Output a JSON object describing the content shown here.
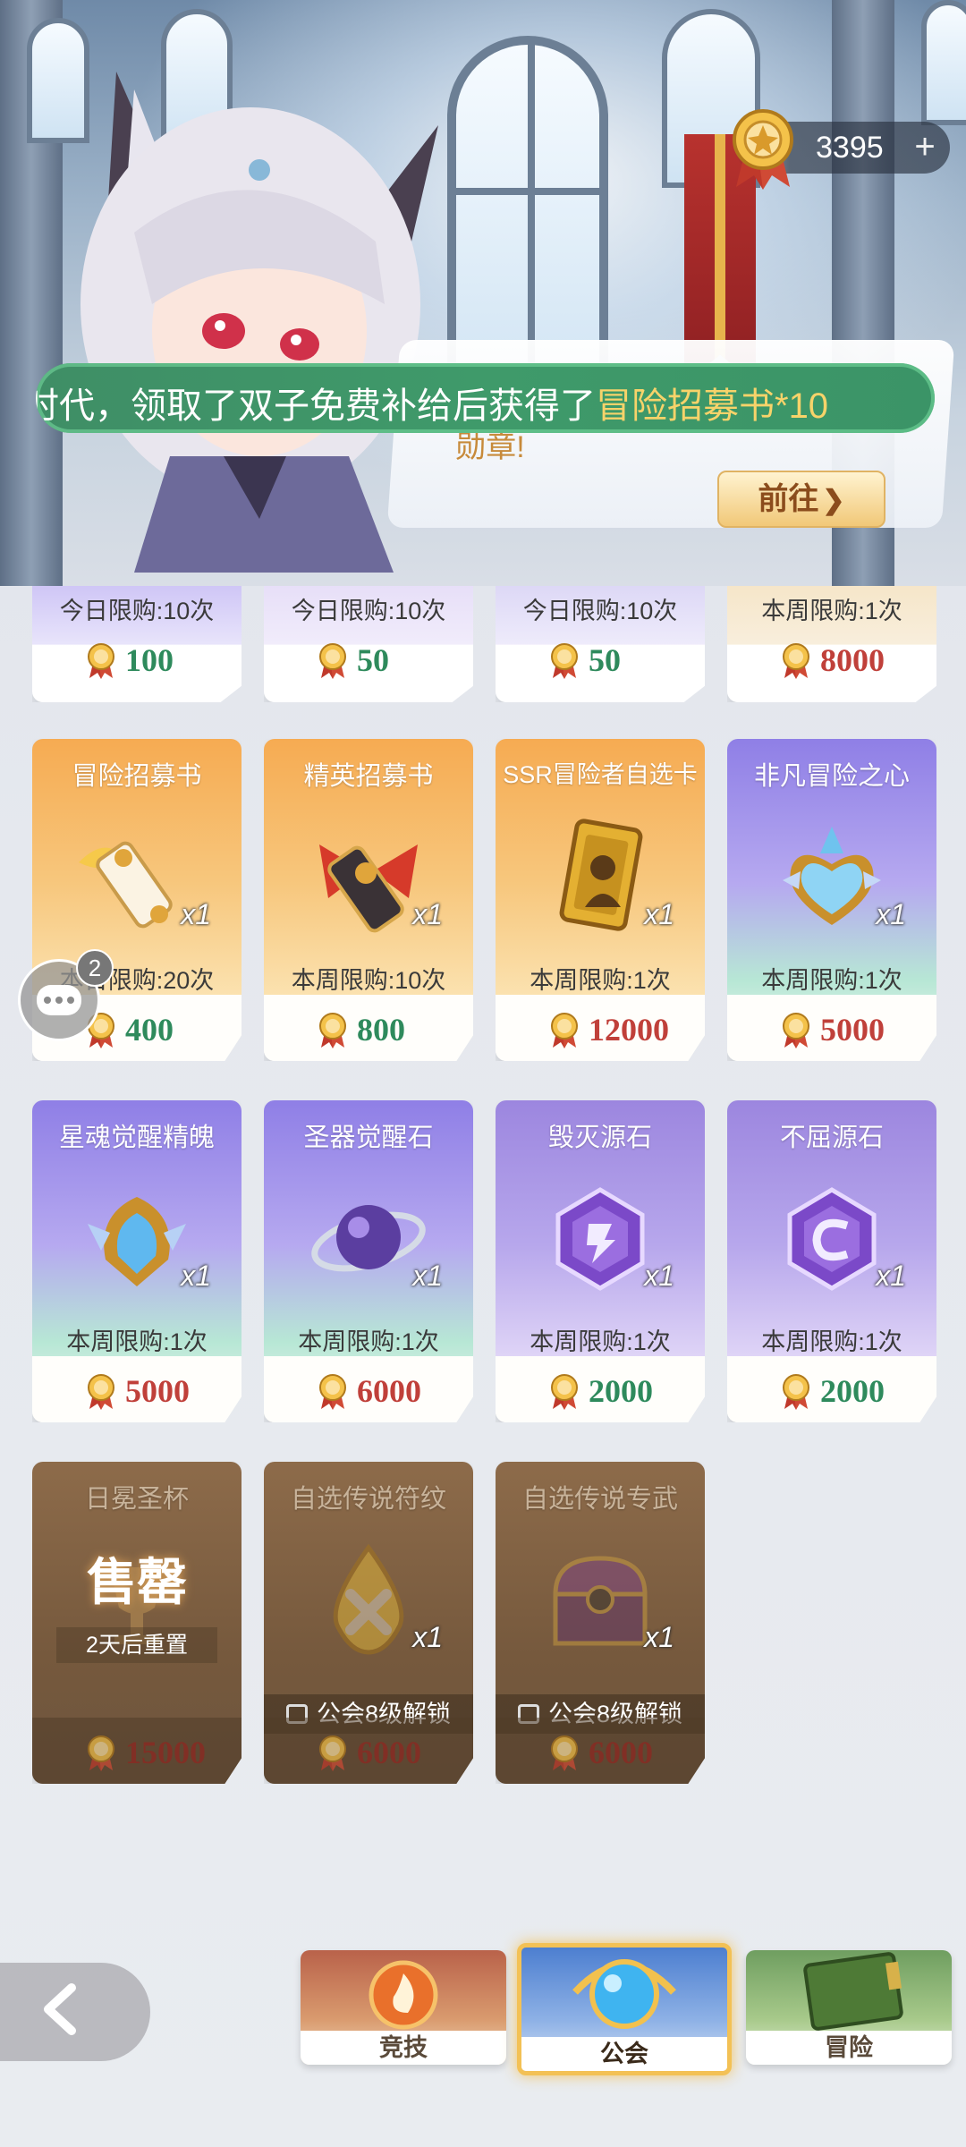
{
  "currency": {
    "amount": "3395",
    "plus_icon": "plus-icon",
    "coin_icon": "medal-coin-icon"
  },
  "hero": {
    "speech_text": "勋章!",
    "goto_label": "前往",
    "goto_icon": "chevron-right-icon"
  },
  "notice": {
    "prefix": "时代，领取了双子免费补给后获得了",
    "highlight": "冒险招募书*10"
  },
  "partial_row": [
    {
      "limit": "今日限购:10次",
      "price": "100",
      "price_color": "green"
    },
    {
      "limit": "今日限购:10次",
      "price": "50",
      "price_color": "green"
    },
    {
      "limit": "今日限购:10次",
      "price": "50",
      "price_color": "green"
    },
    {
      "limit": "本周限购:1次",
      "price": "8000",
      "price_color": "red"
    }
  ],
  "row1": [
    {
      "name": "冒险招募书",
      "icon": "scroll-icon",
      "qty": "x1",
      "limit": "本日限购:20次",
      "price": "400",
      "price_color": "green"
    },
    {
      "name": "精英招募书",
      "icon": "elite-scroll-icon",
      "qty": "x1",
      "limit": "本周限购:10次",
      "price": "800",
      "price_color": "green"
    },
    {
      "name": "SSR冒险者自选卡",
      "icon": "card-icon",
      "qty": "x1",
      "limit": "本周限购:1次",
      "price": "12000",
      "price_color": "red"
    },
    {
      "name": "非凡冒险之心",
      "icon": "heart-crystal-icon",
      "qty": "x1",
      "limit": "本周限购:1次",
      "price": "5000",
      "price_color": "red"
    }
  ],
  "row2": [
    {
      "name": "星魂觉醒精魄",
      "icon": "crystal-gem-icon",
      "qty": "x1",
      "limit": "本周限购:1次",
      "price": "5000",
      "price_color": "red"
    },
    {
      "name": "圣器觉醒石",
      "icon": "orb-icon",
      "qty": "x1",
      "limit": "本周限购:1次",
      "price": "6000",
      "price_color": "red"
    },
    {
      "name": "毁灭源石",
      "icon": "destruction-stone-icon",
      "qty": "x1",
      "limit": "本周限购:1次",
      "price": "2000",
      "price_color": "green"
    },
    {
      "name": "不屈源石",
      "icon": "unyielding-stone-icon",
      "qty": "x1",
      "limit": "本周限购:1次",
      "price": "2000",
      "price_color": "green"
    }
  ],
  "row3": [
    {
      "name": "日冕圣杯",
      "icon": "grail-icon",
      "sold": "售罄",
      "reset": "2天后重置",
      "price": "15000"
    },
    {
      "name": "自选传说符纹",
      "icon": "rune-drop-icon",
      "qty": "x1",
      "lock": "公会8级解锁",
      "price": "6000"
    },
    {
      "name": "自选传说专武",
      "icon": "treasure-chest-icon",
      "qty": "x1",
      "lock": "公会8级解锁",
      "price": "6000"
    }
  ],
  "chat": {
    "badge": "2",
    "icon": "chat-bubble-icon"
  },
  "nav": {
    "back_icon": "back-arrow-icon",
    "tabs": [
      {
        "label": "竞技",
        "icon": "flame-emblem-icon"
      },
      {
        "label": "公会",
        "icon": "blue-orb-icon",
        "active": true
      },
      {
        "label": "冒险",
        "icon": "book-icon"
      }
    ]
  },
  "colors": {
    "price_green": "#2e8a5c",
    "price_red": "#c0403a",
    "notice_bg": "#3f9a6a",
    "notice_highlight": "#f7d36a",
    "active_tab_border": "#f3c155"
  }
}
